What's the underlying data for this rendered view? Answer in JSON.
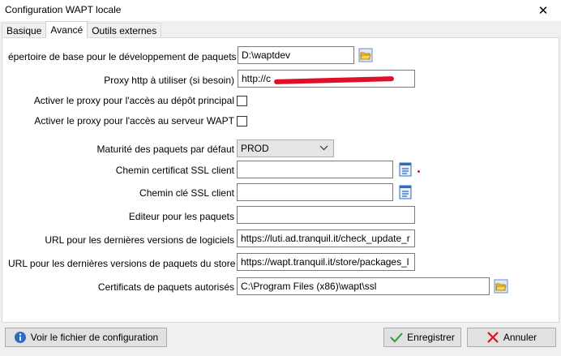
{
  "window": {
    "title": "Configuration WAPT locale",
    "close_glyph": "✕"
  },
  "tabs": [
    {
      "label": "Basique",
      "active": false
    },
    {
      "label": "Avancé",
      "active": true
    },
    {
      "label": "Outils externes",
      "active": false
    }
  ],
  "form": {
    "base_dir": {
      "label": "épertoire de base pour le développement de paquets",
      "value": "D:\\waptdev"
    },
    "proxy": {
      "label": "Proxy http à utiliser (si besoin)",
      "value": "http://c"
    },
    "proxy_repo": {
      "label": "Activer le proxy pour l'accès au dépôt principal",
      "checked": false
    },
    "proxy_server": {
      "label": "Activer le proxy pour l'accès au serveur WAPT",
      "checked": false
    },
    "maturity": {
      "label": "Maturité des paquets par défaut",
      "value": "PROD"
    },
    "ssl_cert": {
      "label": "Chemin certificat SSL client",
      "value": ""
    },
    "ssl_key": {
      "label": "Chemin clé SSL client",
      "value": ""
    },
    "editor": {
      "label": "Editeur pour les paquets",
      "value": ""
    },
    "url_software": {
      "label": "URL pour les dernières versions de logiciels",
      "value": "https://luti.ad.tranquil.it/check_update_r"
    },
    "url_store": {
      "label": "URL pour les dernières versions de paquets du store",
      "value": "https://wapt.tranquil.it/store/packages_l"
    },
    "certs": {
      "label": "Certificats de paquets autorisés",
      "value": "C:\\Program Files (x86)\\wapt\\ssl"
    }
  },
  "buttons": {
    "view_config": "Voir le fichier de configuration",
    "save": "Enregistrer",
    "cancel": "Annuler"
  },
  "icons": {
    "folder": "folder-open-icon",
    "file": "document-icon",
    "info": "info-icon",
    "check": "checkmark-icon",
    "cancel": "cross-icon"
  },
  "colors": {
    "accent_red": "#e0102a",
    "check_green": "#2e9b3e",
    "folder_yellow": "#f2c230",
    "doc_blue": "#2b6cc4"
  }
}
